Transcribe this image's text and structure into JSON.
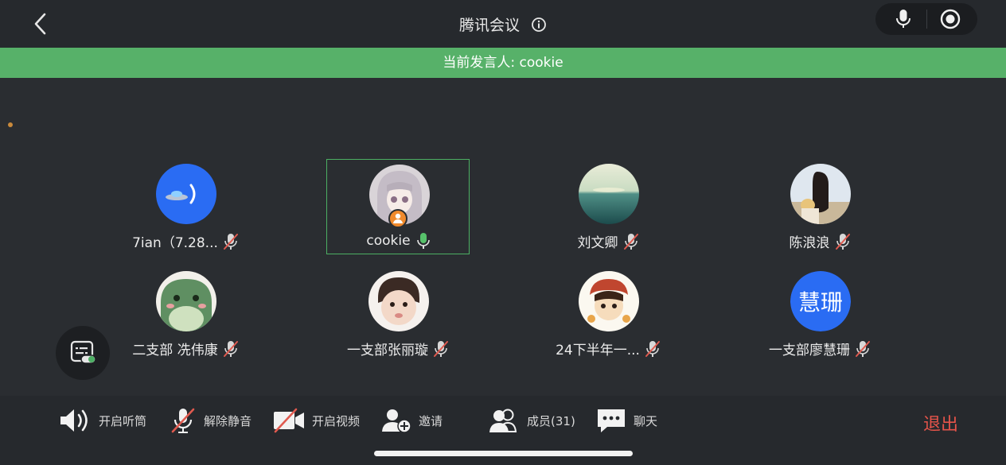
{
  "header": {
    "title": "腾讯会议",
    "speaker_banner": "当前发言人: cookie"
  },
  "participants": [
    {
      "name": "7ian（7.28...",
      "mic": "muted",
      "avatar": "ufo",
      "active": false
    },
    {
      "name": "cookie",
      "mic": "on",
      "avatar": "anime-girl",
      "active": true,
      "host": true
    },
    {
      "name": "刘文卿",
      "mic": "muted",
      "avatar": "sea-sunset",
      "active": false
    },
    {
      "name": "陈浪浪",
      "mic": "muted",
      "avatar": "girl-back",
      "active": false
    },
    {
      "name": "二支部 冼伟康",
      "mic": "muted",
      "avatar": "green-frog",
      "active": false
    },
    {
      "name": "一支部张丽璇",
      "mic": "muted",
      "avatar": "baby-face",
      "active": false
    },
    {
      "name": "24下半年一...",
      "mic": "muted",
      "avatar": "cartoon-character",
      "active": false
    },
    {
      "name": "一支部廖慧珊",
      "mic": "muted",
      "avatar": "text",
      "avatar_text": "慧珊",
      "active": false
    }
  ],
  "toolbar": {
    "speaker_label": "开启听筒",
    "unmute_label": "解除静音",
    "video_label": "开启视频",
    "invite_label": "邀请",
    "members_label": "成员(31)",
    "chat_label": "聊天",
    "exit_label": "退出"
  },
  "colors": {
    "banner": "#57b169",
    "active_border": "#4caf63",
    "exit": "#e5544a",
    "avatar_blue": "#2a6cf3",
    "mic_on": "#57c26b",
    "muted_slash": "#e05a4f"
  },
  "icons": {
    "back": "chevron-left-icon",
    "info": "info-icon",
    "top_mic": "microphone-icon",
    "top_record": "record-icon",
    "float": "subtitle-toggle-icon",
    "speaker": "speaker-icon",
    "unmute": "mic-muted-icon",
    "video": "video-off-icon",
    "invite": "add-person-icon",
    "members": "members-icon",
    "chat": "chat-bubble-icon"
  }
}
